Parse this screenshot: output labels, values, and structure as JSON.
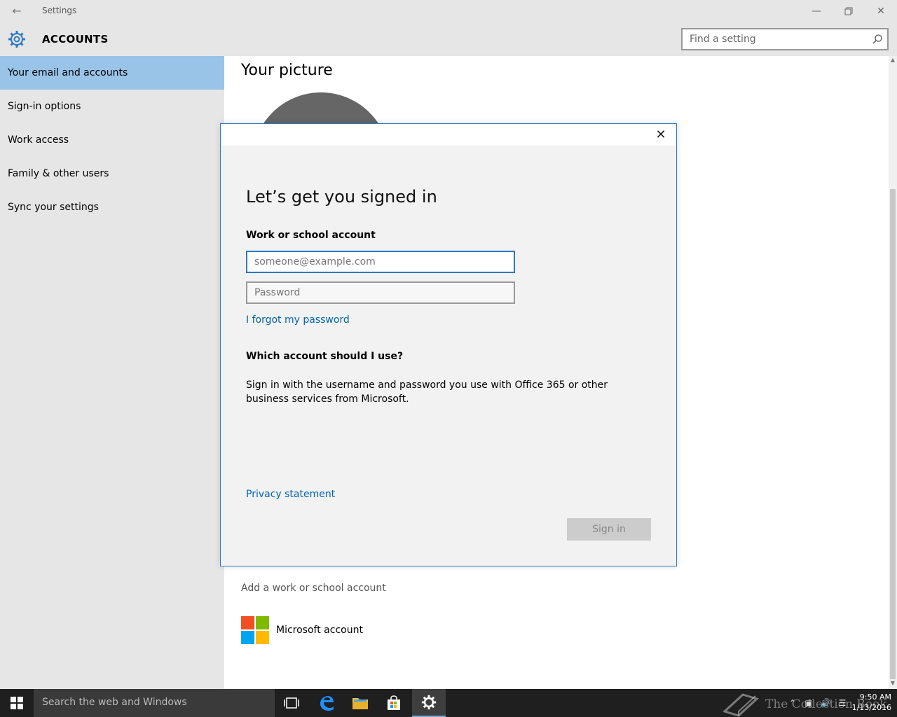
{
  "window": {
    "title": "Settings",
    "back_icon": "back-arrow-icon",
    "min_icon": "minimize-icon",
    "max_icon": "restore-icon",
    "close_icon": "close-icon"
  },
  "header": {
    "section": "ACCOUNTS",
    "search_placeholder": "Find a setting"
  },
  "sidebar": {
    "items": [
      {
        "label": "Your email and accounts",
        "active": true
      },
      {
        "label": "Sign-in options"
      },
      {
        "label": "Work access"
      },
      {
        "label": "Family & other users"
      },
      {
        "label": "Sync your settings"
      }
    ]
  },
  "content": {
    "picture_title": "Your picture",
    "add_work_link": "Add a work or school account",
    "microsoft_account": "Microsoft account",
    "ms_colors": [
      "#f25022",
      "#7fba00",
      "#00a4ef",
      "#ffb900"
    ]
  },
  "dialog": {
    "title": "Let’s get you signed in",
    "account_label": "Work or school account",
    "email_placeholder": "someone@example.com",
    "password_placeholder": "Password",
    "forgot_link": "I forgot my password",
    "which_heading": "Which account should I use?",
    "description": "Sign in with the username and password you use with Office 365 or other business services from Microsoft.",
    "privacy_link": "Privacy statement",
    "signin_button": "Sign in"
  },
  "taskbar": {
    "search_placeholder": "Search the web and Windows",
    "time": "9:50 AM",
    "date": "1/13/2016",
    "watermark": "The Collection Book"
  },
  "colors": {
    "accent": "#2b79c2",
    "link": "#0063b1",
    "active_item": "#99c4e8"
  }
}
